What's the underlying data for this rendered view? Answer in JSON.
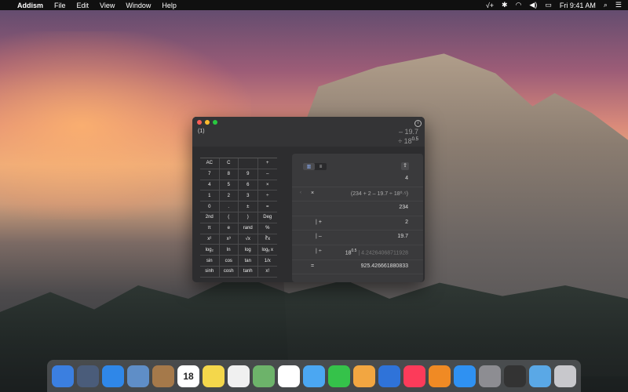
{
  "menu": {
    "apple": "",
    "app_name": "Addism",
    "items": [
      "File",
      "Edit",
      "View",
      "Window",
      "Help"
    ],
    "right": {
      "time": "Fri 9:41 AM"
    }
  },
  "calculator": {
    "memory": "(1)",
    "display": {
      "line1": "– 19.7",
      "line2_op": "÷ 18",
      "line2_exp": "0.5"
    },
    "keypad": [
      "AC",
      "C",
      "",
      "+",
      "7",
      "8",
      "9",
      "–",
      "4",
      "5",
      "6",
      "×",
      "1",
      "2",
      "3",
      "÷",
      "0",
      ".",
      "±",
      "=",
      "2nd",
      "(",
      ")",
      "Deg",
      "π",
      "e",
      "rand",
      "%",
      "x²",
      "x³",
      "√x",
      "∛x",
      "log₂",
      "ln",
      "log",
      "logᵧ x",
      "sin",
      "cos",
      "tan",
      "1/x",
      "sinh",
      "cosh",
      "tanh",
      "x!"
    ],
    "tape": {
      "rows": [
        {
          "op": "",
          "value": "4"
        },
        {
          "op": "×",
          "expr": "(234 + 2 – 19.7 ÷ 18⁰·⁵)"
        },
        {
          "op": "",
          "value": "234"
        },
        {
          "op": "+",
          "value": "2"
        },
        {
          "op": "–",
          "value": "19.7"
        },
        {
          "op": "÷",
          "value_main": "18",
          "value_exp": "0.5",
          "value_muted": "| 4.24264068711928"
        },
        {
          "op": "=",
          "value": "925.426661880833"
        }
      ]
    }
  },
  "dock": {
    "icons": [
      "finder-icon",
      "launchpad-icon",
      "safari-icon",
      "preview-icon",
      "contacts-icon",
      "calendar-icon",
      "notes-icon",
      "reminders-icon",
      "maps-icon",
      "photos-icon",
      "messages-icon",
      "facetime-icon",
      "pages-icon",
      "keynote-icon",
      "music-icon",
      "books-icon",
      "appstore-icon",
      "settings-icon",
      "addism-icon",
      "folder-icon",
      "trash-icon"
    ],
    "calendar_day": "18"
  }
}
